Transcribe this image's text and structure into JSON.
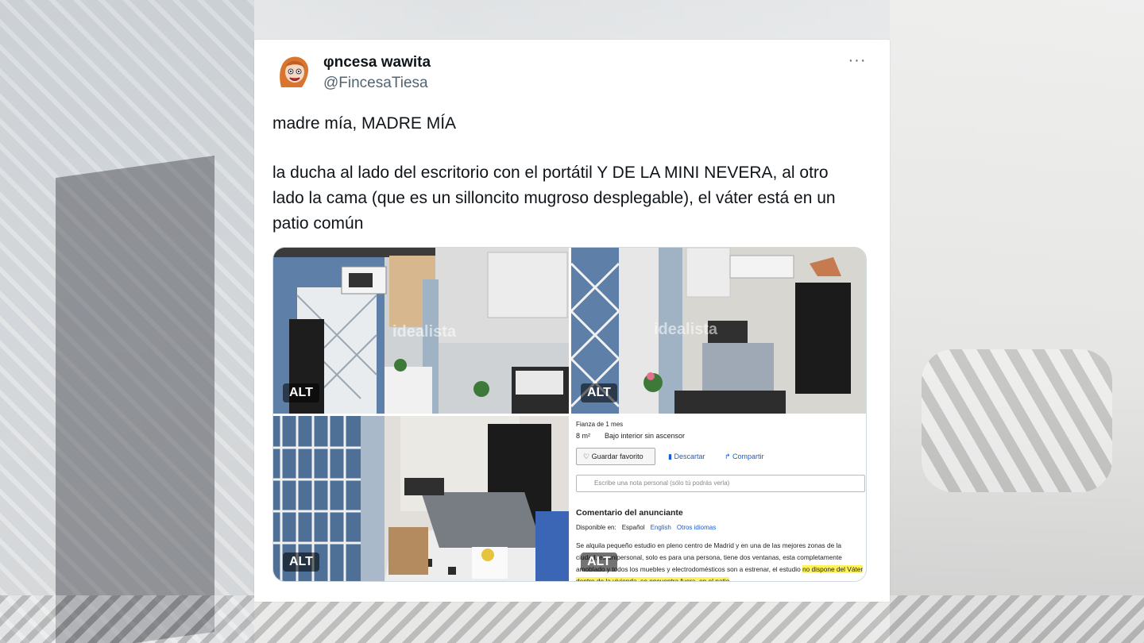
{
  "tweet": {
    "display_name": "φncesa wawita",
    "handle": "@FincesaTiesa",
    "more_label": "···",
    "text_line1": "madre mía, MADRE MÍA",
    "text_line2": "la ducha al lado del escritorio con el portátil Y DE LA MINI NEVERA, al otro lado la cama (que es un silloncito mugroso desplegable), el váter está en un patio común"
  },
  "media": {
    "alt_label": "ALT",
    "watermark": "idealista"
  },
  "listing": {
    "deposit": "Fianza de 1 mes",
    "size": "8 m²",
    "floor": "Bajo interior sin ascensor",
    "save_favorite": "♡ Guardar favorito",
    "discard": "Descartar",
    "share": "Compartir",
    "note_placeholder": "Escribe una nota personal (sólo tú podrás verla)",
    "comment_title": "Comentario del anunciante",
    "available_in": "Disponible en:",
    "lang_es": "Español",
    "lang_en": "English",
    "lang_other": "Otros idiomas",
    "body_1": "Se alquila pequeño estudio en pleno centro de Madrid y en una de las mejores zonas de la ciudad, es unipersonal, solo es para una persona, tiene dos ventanas, esta completamente amoblado y todos los muebles y electrodomésticos son a estrenar, el estudio ",
    "body_highlight": "no dispone del Váter dentro de la vivienda, se encuentra fuera, en el patio"
  },
  "colors": {
    "text": "#0f1419",
    "secondary": "#536471",
    "link_blue": "#1a5bd0",
    "highlight": "#fff35c"
  }
}
